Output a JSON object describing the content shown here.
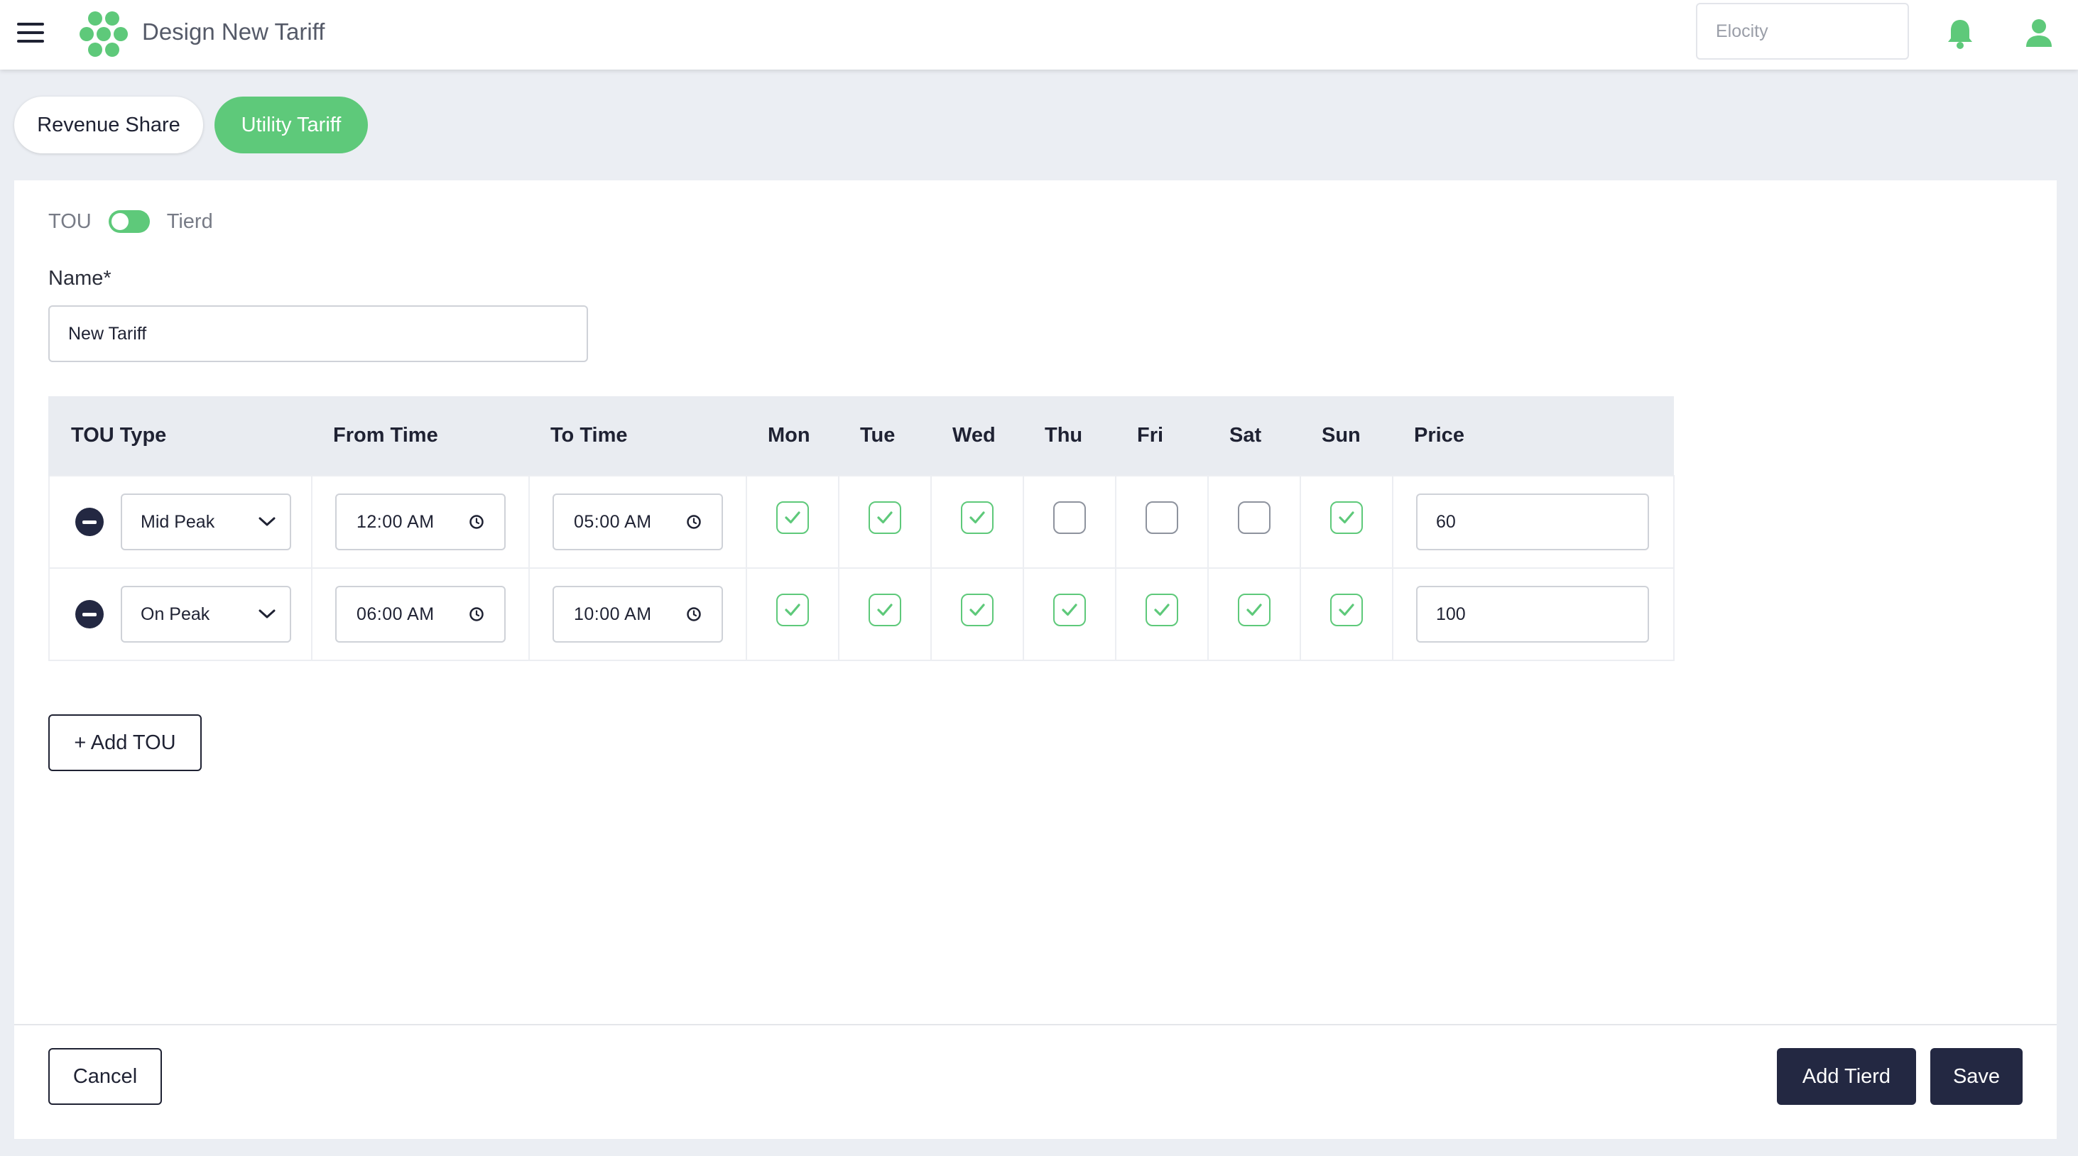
{
  "header": {
    "title": "Design New Tariff",
    "tenant_placeholder": "Elocity",
    "icons": [
      "menu-icon",
      "logo-icon",
      "bell-icon",
      "user-icon"
    ],
    "accent_color": "#5ec97a"
  },
  "tabs": [
    {
      "label": "Revenue Share",
      "active": false
    },
    {
      "label": "Utility Tariff",
      "active": true
    }
  ],
  "mode_toggle": {
    "left_label": "TOU",
    "right_label": "Tierd"
  },
  "name_field": {
    "label": "Name*",
    "value": "New Tariff"
  },
  "table": {
    "headers": [
      "TOU Type",
      "From Time",
      "To Time",
      "Mon",
      "Tue",
      "Wed",
      "Thu",
      "Fri",
      "Sat",
      "Sun",
      "Price"
    ],
    "rows": [
      {
        "type": "Mid Peak",
        "from": "12:00 AM",
        "to": "05:00 AM",
        "days": [
          true,
          true,
          true,
          false,
          false,
          false,
          true
        ],
        "price": "60"
      },
      {
        "type": "On Peak",
        "from": "06:00 AM",
        "to": "10:00 AM",
        "days": [
          true,
          true,
          true,
          true,
          true,
          true,
          true
        ],
        "price": "100"
      }
    ]
  },
  "actions": {
    "add_tou": "+ Add TOU",
    "cancel": "Cancel",
    "add_tiered": "Add Tierd",
    "save": "Save"
  }
}
